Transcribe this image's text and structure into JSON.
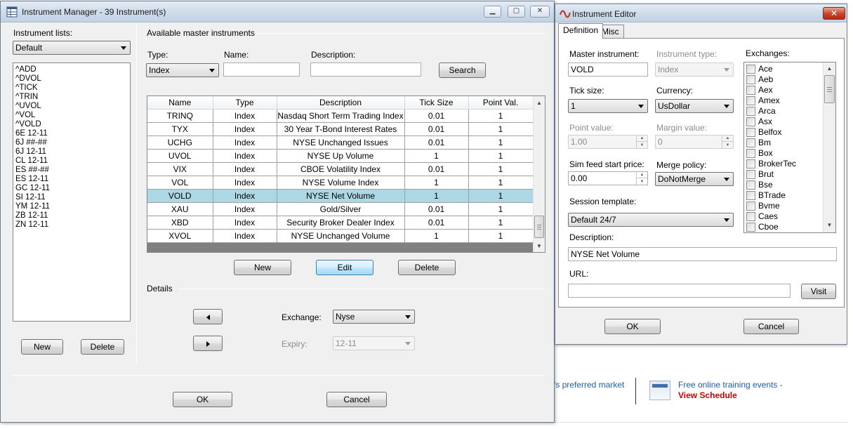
{
  "background": {
    "text_fragment": "'s preferred market",
    "text_fragment2": "e",
    "training_text": "Free online training events -",
    "schedule_link": "View Schedule"
  },
  "manager": {
    "title": "Instrument Manager - 39 Instrument(s)",
    "instrument_lists_label": "Instrument lists:",
    "instrument_lists_value": "Default",
    "list_items": [
      "^ADD",
      "^DVOL",
      "^TICK",
      "^TRIN",
      "^UVOL",
      "^VOL",
      "^VOLD",
      "6E 12-11",
      "6J ##-##",
      "6J 12-11",
      "CL 12-11",
      "ES ##-##",
      "ES 12-11",
      "GC 12-11",
      "SI 12-11",
      "YM 12-11",
      "ZB 12-11",
      "ZN 12-11"
    ],
    "left_new": "New",
    "left_delete": "Delete",
    "available_label": "Available master instruments",
    "type_label": "Type:",
    "type_value": "Index",
    "name_label": "Name:",
    "name_value": "",
    "description_label": "Description:",
    "description_value": "",
    "search_button": "Search",
    "columns": [
      "Name",
      "Type",
      "Description",
      "Tick Size",
      "Point Val."
    ],
    "rows": [
      [
        "TRINQ",
        "Index",
        "Nasdaq Short Term Trading Index",
        "0.01",
        "1"
      ],
      [
        "TYX",
        "Index",
        "30 Year T-Bond Interest Rates",
        "0.01",
        "1"
      ],
      [
        "UCHG",
        "Index",
        "NYSE Unchanged Issues",
        "0.01",
        "1"
      ],
      [
        "UVOL",
        "Index",
        "NYSE Up Volume",
        "1",
        "1"
      ],
      [
        "VIX",
        "Index",
        "CBOE Volatility Index",
        "0.01",
        "1"
      ],
      [
        "VOL",
        "Index",
        "NYSE Volume Index",
        "1",
        "1"
      ],
      [
        "VOLD",
        "Index",
        "NYSE Net Volume",
        "1",
        "1"
      ],
      [
        "XAU",
        "Index",
        "Gold/Silver",
        "0.01",
        "1"
      ],
      [
        "XBD",
        "Index",
        "Security Broker Dealer Index",
        "0.01",
        "1"
      ],
      [
        "XVOL",
        "Index",
        "NYSE Unchanged Volume",
        "1",
        "1"
      ]
    ],
    "selected_row": 6,
    "new_button": "New",
    "edit_button": "Edit",
    "delete_button": "Delete",
    "details_label": "Details",
    "exchange_label": "Exchange:",
    "exchange_value": "Nyse",
    "expiry_label": "Expiry:",
    "expiry_value": "12-11",
    "ok_button": "OK",
    "cancel_button": "Cancel"
  },
  "editor": {
    "title": "Instrument Editor",
    "close_glyph": "✕",
    "tab_definition": "Definition",
    "tab_misc": "Misc",
    "master_instrument_label": "Master instrument:",
    "master_instrument_value": "VOLD",
    "instrument_type_label": "Instrument type:",
    "instrument_type_value": "Index",
    "exchanges_label": "Exchanges:",
    "tick_size_label": "Tick size:",
    "tick_size_value": "1",
    "currency_label": "Currency:",
    "currency_value": "UsDollar",
    "point_value_label": "Point value:",
    "point_value_value": "1.00",
    "margin_value_label": "Margin value:",
    "margin_value_value": "0",
    "sim_feed_label": "Sim feed start price:",
    "sim_feed_value": "0.00",
    "merge_policy_label": "Merge policy:",
    "merge_policy_value": "DoNotMerge",
    "session_template_label": "Session template:",
    "session_template_value": "Default 24/7",
    "description_label": "Description:",
    "description_value": "NYSE Net Volume",
    "url_label": "URL:",
    "url_value": "",
    "visit_button": "Visit",
    "exchanges": [
      "Ace",
      "Aeb",
      "Aex",
      "Amex",
      "Arca",
      "Asx",
      "Belfox",
      "Bm",
      "Box",
      "BrokerTec",
      "Brut",
      "Bse",
      "BTrade",
      "Bvme",
      "Caes",
      "Cboe"
    ],
    "ok_button": "OK",
    "cancel_button": "Cancel"
  }
}
